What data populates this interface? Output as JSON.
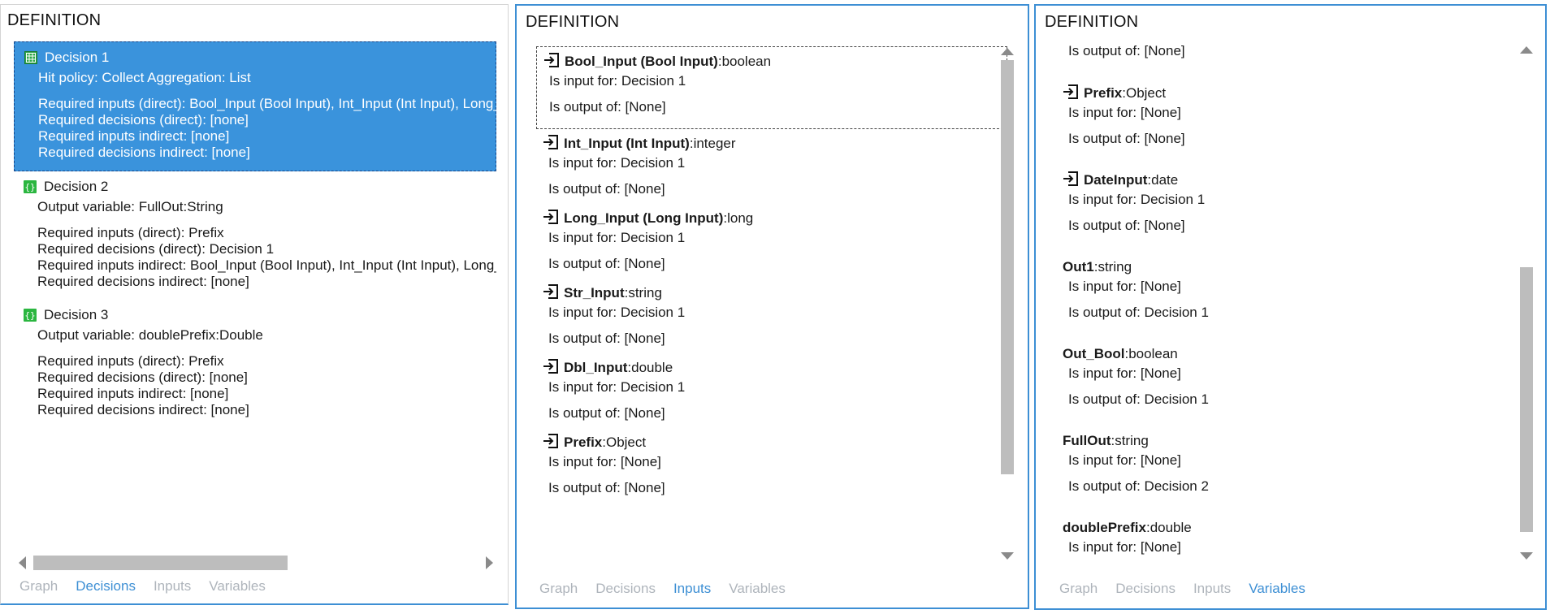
{
  "panels": {
    "decisions_panel": {
      "title": "DEFINITION",
      "decisions": [
        {
          "name": "Decision 1",
          "icon": "decision-table-icon",
          "lines": [
            "Hit policy: Collect  Aggregation: List",
            "Required inputs (direct): Bool_Input (Bool Input), Int_Input (Int Input), Long_Input (Long Input)",
            "Required decisions (direct): [none]",
            "Required inputs indirect: [none]",
            "Required decisions indirect: [none]"
          ]
        },
        {
          "name": "Decision 2",
          "icon": "literal-expression-icon",
          "lines": [
            "Output variable: FullOut:String",
            "Required inputs (direct): Prefix",
            "Required decisions (direct): Decision 1",
            "Required inputs indirect: Bool_Input (Bool Input), Int_Input (Int Input), Long_Input (Long Input)",
            "Required decisions indirect: [none]"
          ]
        },
        {
          "name": "Decision 3",
          "icon": "literal-expression-icon",
          "lines": [
            "Output variable: doublePrefix:Double",
            "Required inputs (direct): Prefix",
            "Required decisions (direct): [none]",
            "Required inputs indirect: [none]",
            "Required decisions indirect: [none]"
          ]
        }
      ],
      "tabs": [
        "Graph",
        "Decisions",
        "Inputs",
        "Variables"
      ],
      "active_tab": "Decisions"
    },
    "inputs_panel": {
      "title": "DEFINITION",
      "items": [
        {
          "name": "Bool_Input (Bool Input)",
          "type": ":boolean",
          "input_for": "Is input for: Decision 1",
          "output_of": "Is output of: [None]"
        },
        {
          "name": "Int_Input (Int Input)",
          "type": ":integer",
          "input_for": "Is input for: Decision 1",
          "output_of": "Is output of: [None]"
        },
        {
          "name": "Long_Input (Long Input)",
          "type": ":long",
          "input_for": "Is input for: Decision 1",
          "output_of": "Is output of: [None]"
        },
        {
          "name": "Str_Input",
          "type": ":string",
          "input_for": "Is input for: Decision 1",
          "output_of": "Is output of: [None]"
        },
        {
          "name": "Dbl_Input",
          "type": ":double",
          "input_for": "Is input for: Decision 1",
          "output_of": "Is output of: [None]"
        },
        {
          "name": "Prefix",
          "type": ":Object",
          "input_for": "Is input for: [None]",
          "output_of": "Is output of: [None]"
        }
      ],
      "tabs": [
        "Graph",
        "Decisions",
        "Inputs",
        "Variables"
      ],
      "active_tab": "Inputs"
    },
    "variables_panel": {
      "title": "DEFINITION",
      "top_partial_line": "Is output of: [None]",
      "items": [
        {
          "name": "Prefix",
          "type": ":Object",
          "is_input": true,
          "input_for": "Is input for: [None]",
          "output_of": "Is output of: [None]"
        },
        {
          "name": "DateInput",
          "type": ":date",
          "is_input": true,
          "input_for": "Is input for: Decision 1",
          "output_of": "Is output of: [None]"
        },
        {
          "name": "Out1",
          "type": ":string",
          "is_input": false,
          "input_for": "Is input for: [None]",
          "output_of": "Is output of: Decision 1"
        },
        {
          "name": "Out_Bool",
          "type": ":boolean",
          "is_input": false,
          "input_for": "Is input for: [None]",
          "output_of": "Is output of: Decision 1"
        },
        {
          "name": "FullOut",
          "type": ":string",
          "is_input": false,
          "input_for": "Is input for: [None]",
          "output_of": "Is output of: Decision 2"
        },
        {
          "name": "doublePrefix",
          "type": ":double",
          "is_input": false,
          "input_for": "Is input for: [None]",
          "output_of": ""
        }
      ],
      "tabs": [
        "Graph",
        "Decisions",
        "Inputs",
        "Variables"
      ],
      "active_tab": "Variables"
    }
  },
  "colors": {
    "selection": "#3a93dc",
    "active_tab": "#3d8fd4",
    "inactive_tab": "#aeb4bb",
    "decision_icon": "#2bb640",
    "scroll_thumb": "#bdbdbd"
  }
}
